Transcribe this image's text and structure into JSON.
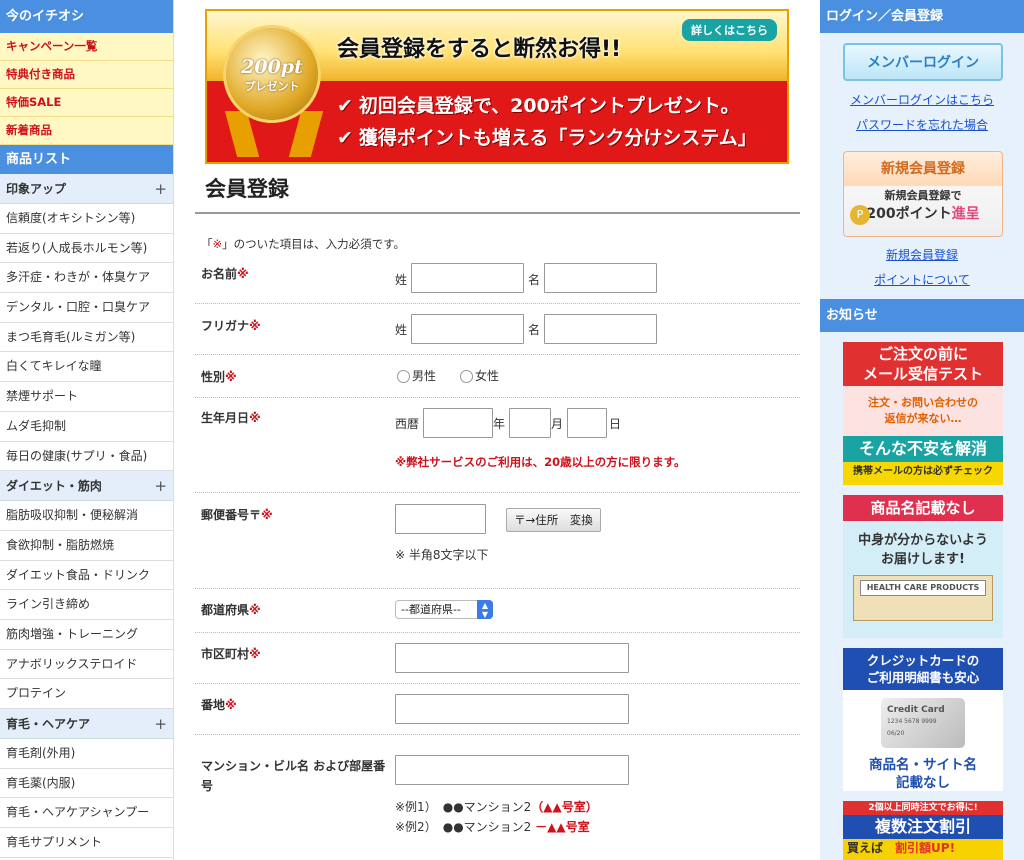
{
  "left": {
    "featured_title": "今のイチオシ",
    "promos": [
      "キャンペーン一覧",
      "特典付き商品",
      "特価SALE",
      "新着商品"
    ],
    "product_list_title": "商品リスト",
    "categories": [
      {
        "label": "印象アップ",
        "toggle": "+",
        "items": [
          "信頼度(オキシトシン等)",
          "若返り(人成長ホルモン等)",
          "多汗症・わきが・体臭ケア",
          "デンタル・口腔・口臭ケア",
          "まつ毛育毛(ルミガン等)",
          "白くてキレイな瞳",
          "禁煙サポート",
          "ムダ毛抑制",
          "毎日の健康(サプリ・食品)"
        ]
      },
      {
        "label": "ダイエット・筋肉",
        "toggle": "+",
        "items": [
          "脂肪吸収抑制・便秘解消",
          "食欲抑制・脂肪燃焼",
          "ダイエット食品・ドリンク",
          "ライン引き締め",
          "筋肉増強・トレーニング",
          "アナボリックステロイド",
          "プロテイン"
        ]
      },
      {
        "label": "育毛・ヘアケア",
        "toggle": "+",
        "items": [
          "育毛剤(外用)",
          "育毛薬(内服)",
          "育毛・ヘアケアシャンプー",
          "育毛サプリメント"
        ]
      }
    ]
  },
  "banner": {
    "medal_big": "200pt",
    "medal_small": "プレゼント",
    "headline": "会員登録をすると断然お得!!",
    "more": "詳しくはこちら",
    "line1": "初回会員登録で、200ポイントプレゼント。",
    "line2": "獲得ポイントも増える「ランク分けシステム」",
    "check": "✔"
  },
  "form": {
    "title": "会員登録",
    "note_prefix": "「",
    "note_mark": "※",
    "note_suffix": "」のついた項目は、入力必須です。",
    "req": "※",
    "name_label": "お名前",
    "kana_label": "フリガナ",
    "sei": "姓",
    "mei": "名",
    "gender_label": "性別",
    "male": "男性",
    "female": "女性",
    "birth_label": "生年月日",
    "seireki": "西暦",
    "year": "年",
    "month": "月",
    "day": "日",
    "age_warning": "※弊社サービスのご利用は、20歳以上の方に限ります。",
    "zip_label": "郵便番号〒",
    "zip_button": "〒→住所　変換",
    "zip_hint": "※ 半角8文字以下",
    "pref_label": "都道府県",
    "pref_select": "--都道府県--",
    "city_label": "市区町村",
    "address_label": "番地",
    "building_label": "マンション・ビル名 および部屋番号",
    "ex1_prefix": "※例1）",
    "ex1_text": "●●マンション2",
    "ex1_red": "（▲▲号室）",
    "ex2_prefix": "※例2）",
    "ex2_text": "●●マンション2",
    "ex2_red": "－▲▲号室"
  },
  "right": {
    "login_title": "ログイン／会員登録",
    "member_login_button": "メンバーログイン",
    "member_login_link": "メンバーログインはこちら",
    "forgot_link": "パスワードを忘れた場合",
    "register_title": "新規会員登録",
    "register_sub": "新規会員登録で",
    "register_points": "200ポイント",
    "register_badge": "進呈",
    "register_link": "新規会員登録",
    "points_link": "ポイントについて",
    "news_title": "お知らせ",
    "ads": [
      {
        "l1": "ご注文の前に",
        "l2": "メール受信テスト",
        "l3": "注文・お問い合わせの",
        "l4": "返信が来ない…",
        "l5": "そんな不安を解消",
        "l6": "携帯メールの方は必ずチェック"
      },
      {
        "l1": "商品名記載なし",
        "l2": "中身が分からないよう",
        "l3": "お届けします!",
        "l4": "HEALTH CARE PRODUCTS"
      },
      {
        "l1": "クレジットカードの",
        "l2": "ご利用明細書も安心",
        "l3": "Credit Card",
        "l4": "1234 5678 9999",
        "l5": "06/20",
        "l6": "商品名・サイト名",
        "l7": "記載なし"
      },
      {
        "l1": "2個以上同時注文でお得に!",
        "l2": "複数注文割引",
        "l3": "買えば",
        "l4": "割引額UP!"
      }
    ]
  },
  "colors": {
    "accent": "#4a8fe0",
    "required": "#d0111b",
    "link": "#1a4fcf"
  }
}
